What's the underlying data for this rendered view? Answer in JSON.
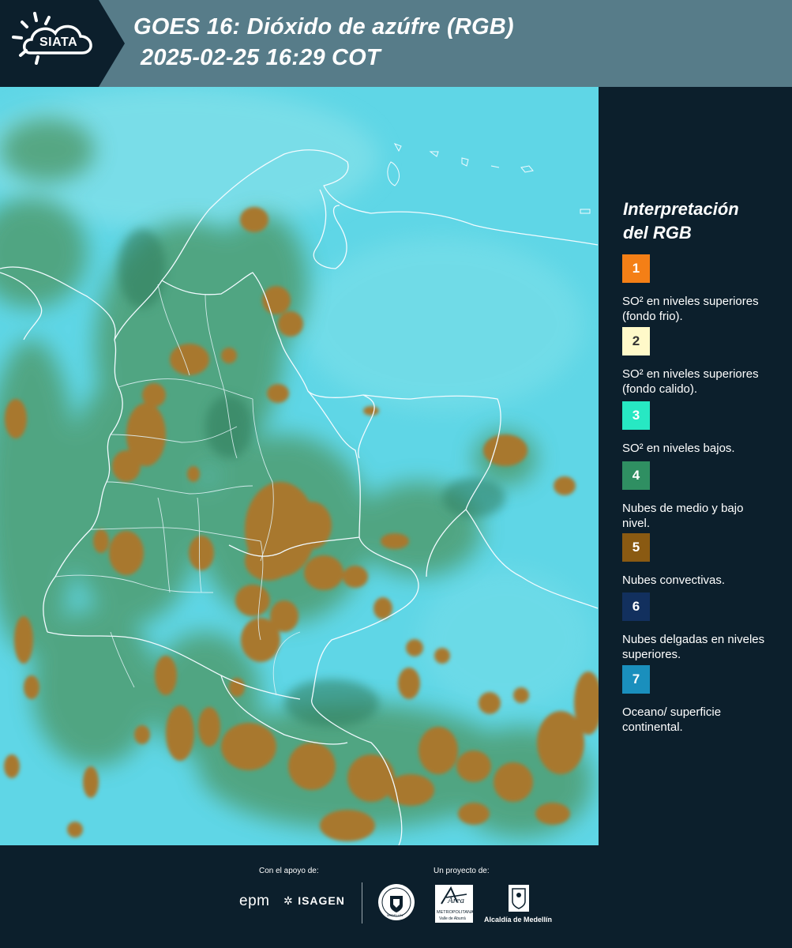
{
  "header": {
    "logo_text": "SIATA",
    "title_line1": "GOES 16: Dióxido de azúfre (RGB)",
    "title_line2": "2025-02-25 16:29 COT"
  },
  "legend": {
    "title_line1": "Interpretación",
    "title_line2": "del RGB",
    "items": [
      {
        "number": "1",
        "text": "SO² en niveles superiores (fondo frio).",
        "color": "#f47f16",
        "number_color": "#ffffff"
      },
      {
        "number": "2",
        "text": "SO² en niveles superiores (fondo calido).",
        "color": "#fff9c9",
        "number_color": "#333333"
      },
      {
        "number": "3",
        "text": "SO² en niveles bajos.",
        "color": "#27e8c3",
        "number_color": "#ffffff"
      },
      {
        "number": "4",
        "text": "Nubes de medio y bajo nivel.",
        "color": "#2f8f62",
        "number_color": "#ffffff"
      },
      {
        "number": "5",
        "text": "Nubes convectivas.",
        "color": "#8a5a12",
        "number_color": "#ffffff"
      },
      {
        "number": "6",
        "text": "Nubes delgadas en niveles superiores.",
        "color": "#12305e",
        "number_color": "#ffffff"
      },
      {
        "number": "7",
        "text": "Oceano/ superficie continental.",
        "color": "#1a8fbd",
        "number_color": "#ffffff"
      }
    ]
  },
  "footer": {
    "support_label": "Con el apoyo de:",
    "project_label": "Un proyecto de:",
    "sponsor_epm": "epm",
    "sponsor_isagen": "ISAGEN",
    "sponsor_area_line1": "Área",
    "sponsor_area_line2": "METROPOLITANA",
    "sponsor_area_line3": "Valle de Aburrá",
    "sponsor_alcaldia": "Alcaldía de Medellín",
    "sponsor_medellin_seal": "MEDELLÍN"
  },
  "colors": {
    "header_bg": "#577c89",
    "logo_bg": "#0c1f2c",
    "legend_bg": "#0c1f2c",
    "ocean": "#5fd6e6",
    "cloud_convective": "#a8782d",
    "cloud_low": "#4e9a6a"
  }
}
